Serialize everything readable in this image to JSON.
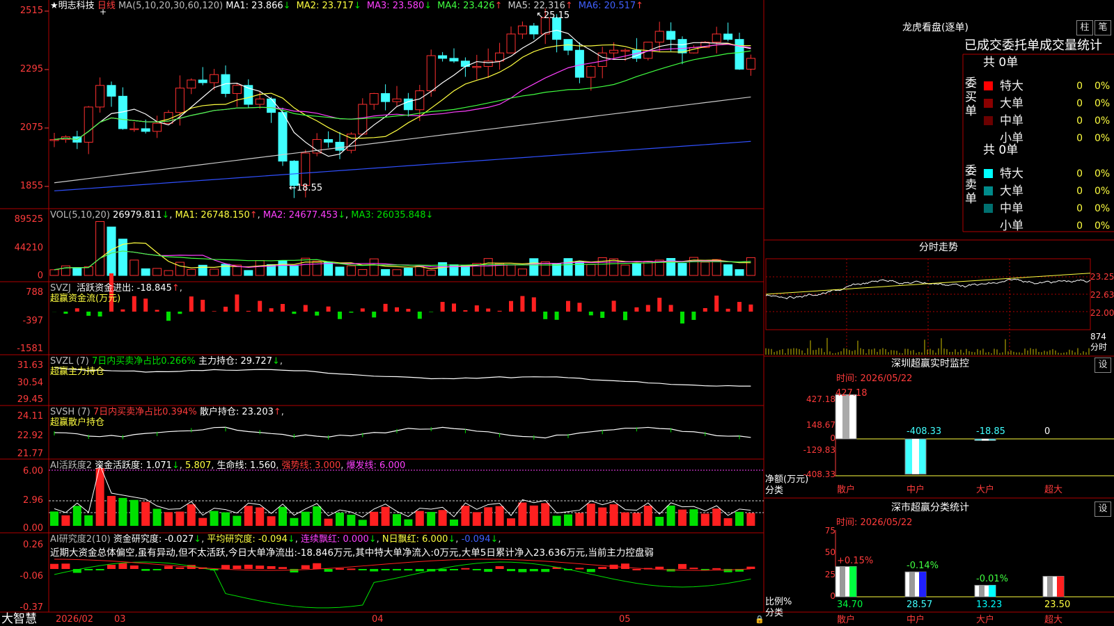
{
  "kline": {
    "name_prefix": "★",
    "stock_name": "明志科技",
    "period": "日线",
    "ma_label": "MA(5,10,20,30,60,120)",
    "ma": [
      {
        "label": "MA1: 23.866",
        "arrow": "↓",
        "color": "#ffffff"
      },
      {
        "label": "MA2: 23.717",
        "arrow": "↓",
        "color": "#ffff40"
      },
      {
        "label": "MA3: 23.580",
        "arrow": "↓",
        "color": "#ff40ff"
      },
      {
        "label": "MA4: 23.426",
        "arrow": "↑",
        "color": "#40ff40"
      },
      {
        "label": "MA5: 22.316",
        "arrow": "↑",
        "color": "#cccccc"
      },
      {
        "label": "MA6: 20.517",
        "arrow": "↑",
        "color": "#4060ff"
      }
    ],
    "y_ticks": [
      "2515",
      "2295",
      "2075",
      "1855"
    ],
    "high_label": "25.15",
    "low_label": "←18.55"
  },
  "vol": {
    "label": "VOL(5,10,20)",
    "value": "26979.811",
    "arrow": "↓",
    "ma1": "MA1: 26748.150",
    "ma1_arrow": "↑",
    "ma2": "MA2: 24677.453",
    "ma2_arrow": "↓",
    "ma3": "MA3: 26035.848",
    "ma3_arrow": "↓",
    "y_ticks": [
      "89525",
      "44210",
      "0"
    ]
  },
  "svzj": {
    "label": "SVZJ",
    "title": "活跃资金进出: -18.845",
    "arrow": "↑",
    "subtitle": "超赢资金流(万元)",
    "y_ticks": [
      "788",
      "-397",
      "-1581"
    ]
  },
  "svzl": {
    "label": "SVZL (7)",
    "text1": "7日内买卖净占比0.266%",
    "text2": "主力持仓: 29.727",
    "arrow": "↓",
    "subtitle": "超赢主力持仓",
    "y_ticks": [
      "31.63",
      "30.54",
      "29.45"
    ]
  },
  "svsh": {
    "label": "SVSH (7)",
    "text1": "7日内买卖净占比0.394%",
    "text2": "散户持仓: 23.203",
    "arrow": "↑",
    "subtitle": "超赢散户持仓",
    "y_ticks": [
      "24.11",
      "22.92",
      "21.77"
    ]
  },
  "ai_active": {
    "label": "AI活跃度2",
    "text1": "资金活跃度: 1.071",
    "text2": "5.807",
    "text3": "生命线: 1.560",
    "text4": "强势线: 3.000",
    "text5": "爆发线: 6.000",
    "y_ticks": [
      "6.00",
      "2.96",
      "0.00"
    ]
  },
  "ai_research": {
    "label": "AI研究度2(10)",
    "text1": "资金研究度: -0.027",
    "text2": "平均研究度: -0.094",
    "text3": "连续飘红: 0.000",
    "text4": "N日飘红: 6.000",
    "text5": "-0.094",
    "comment": "近期大资金总体偏空,虽有异动,但不太活跃,今日大单净流出:-18.846万元,其中特大单净流入:0万元,大单5日累计净入23.636万元,当前主力控盘弱",
    "y_ticks": [
      "0.26",
      "-0.06",
      "-0.37"
    ]
  },
  "x_axis": {
    "brand": "大智慧",
    "labels": [
      "2026/02",
      "03",
      "04",
      "05"
    ]
  },
  "lhb": {
    "title": "龙虎看盘(逐单)",
    "btn1": "柱",
    "btn2": "笔",
    "header": "已成交委托单成交量统计",
    "buy_label": "委买单",
    "sell_label": "委卖单",
    "buy_total": "共 0单",
    "sell_total": "共 0单",
    "rows": [
      "特大",
      "大单",
      "中单",
      "小单"
    ],
    "values": [
      "0",
      "0",
      "0",
      "0"
    ],
    "pcts": [
      "0%",
      "0%",
      "0%",
      "0%"
    ],
    "buy_colors": [
      "#ff0000",
      "#8b0000",
      "#6b0000",
      "#000000"
    ],
    "sell_colors": [
      "#00ffff",
      "#008b8b",
      "#007070",
      "#000000"
    ]
  },
  "intraday": {
    "title": "分时走势",
    "y_ticks": [
      "23.25",
      "22.63",
      "22.00"
    ],
    "vol_tick": "874",
    "vol_unit": "分时"
  },
  "sz_monitor": {
    "title": "深圳超赢实时监控",
    "btn": "设",
    "time": "时间: 2026/05/22",
    "y_ticks": [
      "427.18",
      "148.67",
      "0",
      "-129.83",
      "-408.33"
    ],
    "unit1": "净额(万元)",
    "unit2": "分类",
    "bars": [
      {
        "name": "散户",
        "value": "427.18",
        "v": 427.18
      },
      {
        "name": "中户",
        "value": "-408.33",
        "v": -408.33
      },
      {
        "name": "大户",
        "value": "-18.85",
        "v": -18.85
      },
      {
        "name": "超大",
        "value": "0",
        "v": 0
      }
    ]
  },
  "sz_class": {
    "title": "深市超赢分类统计",
    "btn": "设",
    "time": "时间: 2026/05/22",
    "y_ticks": [
      "75",
      "50",
      "25",
      "0"
    ],
    "unit1": "比例%",
    "unit2": "分类",
    "bars": [
      {
        "name": "散户",
        "value": "34.70",
        "change": "+0.15%",
        "v": 34.7,
        "color": "#00ff40"
      },
      {
        "name": "中户",
        "value": "28.57",
        "change": "-0.14%",
        "v": 28.57,
        "color": "#2020ff"
      },
      {
        "name": "大户",
        "value": "13.23",
        "change": "-0.01%",
        "v": 13.23,
        "color": "#00ffff"
      },
      {
        "name": "超大",
        "value": "23.50",
        "change": "",
        "v": 23.5,
        "color": "#ff2020"
      }
    ]
  }
}
